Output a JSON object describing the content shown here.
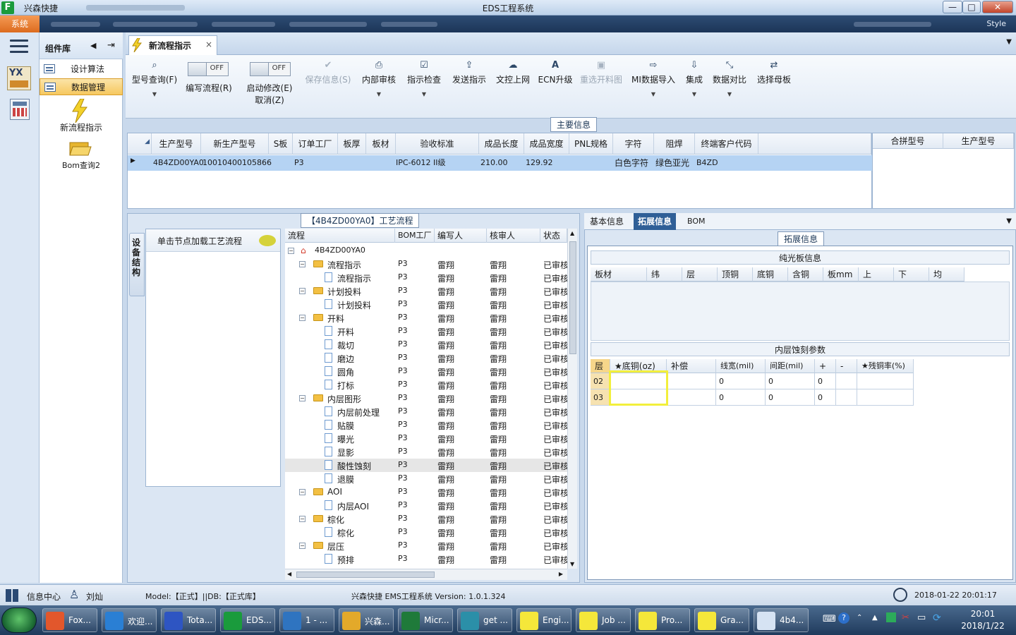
{
  "app": {
    "short_name": "兴森快捷",
    "window_title": "EDS工程系统",
    "menu_system": "系统",
    "style_label": "Style"
  },
  "window_controls": {
    "minimize": "—",
    "maximize": "□",
    "close": "✕"
  },
  "component_panel": {
    "title": "组件库",
    "items": [
      {
        "label": "设计算法"
      },
      {
        "label": "数据管理"
      }
    ],
    "links": [
      {
        "label": "新流程指示"
      },
      {
        "label": "Bom查询2"
      }
    ]
  },
  "tab": {
    "label": "新流程指示",
    "close": "×"
  },
  "toolbar": {
    "buttons": [
      {
        "label": "型号查询(F)",
        "icon": "search-icon"
      },
      {
        "label": "保存信息(S)",
        "icon": "check-icon",
        "disabled": true
      },
      {
        "label": "内部审核",
        "icon": "printer-icon"
      },
      {
        "label": "指示检查",
        "icon": "checkbox-icon"
      },
      {
        "label": "发送指示",
        "icon": "upload-icon"
      },
      {
        "label": "文控上网",
        "icon": "cloud-upload-icon"
      },
      {
        "label": "ECN升级",
        "icon": "font-icon"
      },
      {
        "label": "重选开料图",
        "icon": "image-icon",
        "disabled": true
      },
      {
        "label": "MI数据导入",
        "icon": "import-icon"
      },
      {
        "label": "集成",
        "icon": "download-icon"
      },
      {
        "label": "数据对比",
        "icon": "compress-icon"
      },
      {
        "label": "选择母板",
        "icon": "shuffle-icon"
      }
    ],
    "toggles": [
      {
        "state": "OFF",
        "label": "编写流程(R)"
      },
      {
        "state": "OFF",
        "label": "启动修改(E)",
        "label2": "取消(Z)"
      }
    ]
  },
  "main_info": {
    "section_title": "主要信息",
    "columns": [
      "生产型号",
      "新生产型号",
      "S板",
      "订单工厂",
      "板厚",
      "板材",
      "验收标准",
      "成品长度",
      "成品宽度",
      "PNL规格",
      "字符",
      "阻焊",
      "终端客户代码"
    ],
    "row": {
      "生产型号": "4B4ZD00YA0",
      "新生产型号": "10010400105866",
      "订单工厂": "P3",
      "验收标准": "IPC-6012 II级",
      "成品长度": "210.00",
      "成品宽度": "129.92",
      "字符": "白色字符",
      "阻焊": "绿色亚光",
      "终端客户代码": "B4ZD"
    },
    "merge_columns": [
      "合拼型号",
      "生产型号"
    ]
  },
  "process_panel": {
    "section_title": "【4B4ZD00YA0】工艺流程",
    "side_tab": "设备结构",
    "node_hint": "单击节点加载工艺流程",
    "columns": [
      "流程",
      "BOM工厂",
      "编写人",
      "核审人",
      "状态"
    ],
    "root": "4B4ZD00YA0",
    "rows": [
      {
        "name": "流程指示",
        "level": 1,
        "factory": "P3",
        "writer": "雷翔",
        "reviewer": "雷翔",
        "status": "已审核"
      },
      {
        "name": "流程指示",
        "level": 2,
        "factory": "P3",
        "writer": "雷翔",
        "reviewer": "雷翔",
        "status": "已审核"
      },
      {
        "name": "计划投料",
        "level": 1,
        "factory": "P3",
        "writer": "雷翔",
        "reviewer": "雷翔",
        "status": "已审核"
      },
      {
        "name": "计划投料",
        "level": 2,
        "factory": "P3",
        "writer": "雷翔",
        "reviewer": "雷翔",
        "status": "已审核"
      },
      {
        "name": "开料",
        "level": 1,
        "factory": "P3",
        "writer": "雷翔",
        "reviewer": "雷翔",
        "status": "已审核"
      },
      {
        "name": "开料",
        "level": 2,
        "factory": "P3",
        "writer": "雷翔",
        "reviewer": "雷翔",
        "status": "已审核"
      },
      {
        "name": "裁切",
        "level": 2,
        "factory": "P3",
        "writer": "雷翔",
        "reviewer": "雷翔",
        "status": "已审核"
      },
      {
        "name": "磨边",
        "level": 2,
        "factory": "P3",
        "writer": "雷翔",
        "reviewer": "雷翔",
        "status": "已审核"
      },
      {
        "name": "圆角",
        "level": 2,
        "factory": "P3",
        "writer": "雷翔",
        "reviewer": "雷翔",
        "status": "已审核"
      },
      {
        "name": "打标",
        "level": 2,
        "factory": "P3",
        "writer": "雷翔",
        "reviewer": "雷翔",
        "status": "已审核"
      },
      {
        "name": "内层图形",
        "level": 1,
        "factory": "P3",
        "writer": "雷翔",
        "reviewer": "雷翔",
        "status": "已审核"
      },
      {
        "name": "内层前处理",
        "level": 2,
        "factory": "P3",
        "writer": "雷翔",
        "reviewer": "雷翔",
        "status": "已审核"
      },
      {
        "name": "贴膜",
        "level": 2,
        "factory": "P3",
        "writer": "雷翔",
        "reviewer": "雷翔",
        "status": "已审核"
      },
      {
        "name": "曝光",
        "level": 2,
        "factory": "P3",
        "writer": "雷翔",
        "reviewer": "雷翔",
        "status": "已审核"
      },
      {
        "name": "显影",
        "level": 2,
        "factory": "P3",
        "writer": "雷翔",
        "reviewer": "雷翔",
        "status": "已审核"
      },
      {
        "name": "酸性蚀刻",
        "level": 2,
        "factory": "P3",
        "writer": "雷翔",
        "reviewer": "雷翔",
        "status": "已审核",
        "selected": true
      },
      {
        "name": "退膜",
        "level": 2,
        "factory": "P3",
        "writer": "雷翔",
        "reviewer": "雷翔",
        "status": "已审核"
      },
      {
        "name": "AOI",
        "level": 1,
        "factory": "P3",
        "writer": "雷翔",
        "reviewer": "雷翔",
        "status": "已审核"
      },
      {
        "name": "内层AOI",
        "level": 2,
        "factory": "P3",
        "writer": "雷翔",
        "reviewer": "雷翔",
        "status": "已审核"
      },
      {
        "name": "棕化",
        "level": 1,
        "factory": "P3",
        "writer": "雷翔",
        "reviewer": "雷翔",
        "status": "已审核"
      },
      {
        "name": "棕化",
        "level": 2,
        "factory": "P3",
        "writer": "雷翔",
        "reviewer": "雷翔",
        "status": "已审核"
      },
      {
        "name": "层压",
        "level": 1,
        "factory": "P3",
        "writer": "雷翔",
        "reviewer": "雷翔",
        "status": "已审核"
      },
      {
        "name": "预排",
        "level": 2,
        "factory": "P3",
        "writer": "雷翔",
        "reviewer": "雷翔",
        "status": "已审核"
      }
    ]
  },
  "right_panel": {
    "tabs": [
      "基本信息",
      "拓展信息",
      "BOM"
    ],
    "active_tab": "拓展信息",
    "section_title": "拓展信息",
    "bare_board": {
      "title": "纯光板信息",
      "columns": [
        "板材",
        "纬",
        "层",
        "顶铜",
        "底铜",
        "含铜",
        "板mm",
        "上",
        "下",
        "均"
      ]
    },
    "inner_etch": {
      "title": "内层蚀刻参数",
      "columns": [
        "层",
        "★底铜(oz)",
        "补偿",
        "线宽(mil)",
        "间距(mil)",
        "+",
        "-",
        "★残铜率(%)"
      ],
      "rows": [
        {
          "layer": "02",
          "base_cu": "",
          "comp": "",
          "width": "0",
          "space": "0",
          "plus": "0",
          "minus": "",
          "residual": ""
        },
        {
          "layer": "03",
          "base_cu": "",
          "comp": "",
          "width": "0",
          "space": "0",
          "plus": "0",
          "minus": "",
          "residual": ""
        }
      ]
    }
  },
  "status_bar": {
    "info_center": "信息中心",
    "user": "刘灿",
    "model": "Model:【正式】||DB:【正式库】",
    "version_text": "兴森快捷 EMS工程系统 Version: 1.0.1.324",
    "datetime": "2018-01-22 20:01:17"
  },
  "taskbar": {
    "tasks": [
      {
        "label": "Fox...",
        "color": "#e2572c"
      },
      {
        "label": "欢迎...",
        "color": "#2a7fd4"
      },
      {
        "label": "Tota...",
        "color": "#2e55c2"
      },
      {
        "label": "EDS...",
        "color": "#1a9b3c"
      },
      {
        "label": "1 - ...",
        "color": "#2f74c0"
      },
      {
        "label": "兴森...",
        "color": "#e3a92a"
      },
      {
        "label": "Micr...",
        "color": "#1f7a3a"
      },
      {
        "label": "get ...",
        "color": "#2b8fa8"
      },
      {
        "label": "Engi...",
        "color": "#f5e73a"
      },
      {
        "label": "Job ...",
        "color": "#f5e73a"
      },
      {
        "label": "Pro...",
        "color": "#f5e73a"
      },
      {
        "label": "Gra...",
        "color": "#f5e73a"
      },
      {
        "label": "4b4...",
        "color": "#d6e3f3"
      }
    ],
    "clock_time": "20:01",
    "clock_date": "2018/1/22"
  }
}
